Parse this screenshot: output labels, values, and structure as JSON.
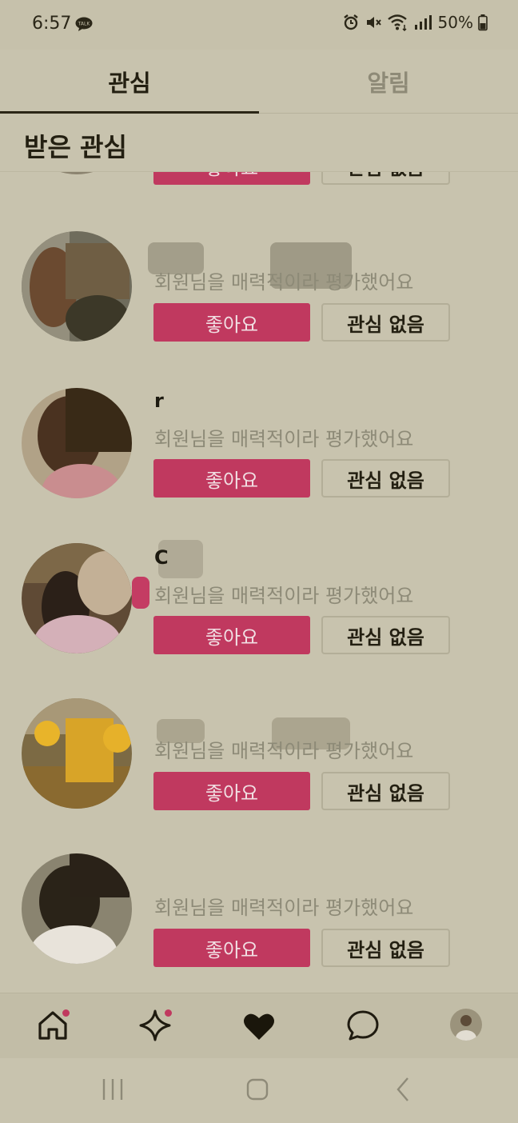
{
  "status_bar": {
    "time": "6:57",
    "talk_badge": "TALK",
    "battery": "50%"
  },
  "tabs": [
    {
      "label": "관심",
      "active": true
    },
    {
      "label": "알림",
      "active": false
    }
  ],
  "section": {
    "title": "받은 관심"
  },
  "items": [
    {
      "name": "",
      "message": "회원님을 매력적이라 평가했어요",
      "like_label": "좋아요",
      "nope_label": "관심 없음"
    },
    {
      "name": "r",
      "message": "회원님을 매력적이라 평가했어요",
      "like_label": "좋아요",
      "nope_label": "관심 없음"
    },
    {
      "name": "C",
      "message": "회원님을 매력적이라 평가했어요",
      "like_label": "좋아요",
      "nope_label": "관심 없음"
    },
    {
      "name": "",
      "message": "회원님을 매력적이라 평가했어요",
      "like_label": "좋아요",
      "nope_label": "관심 없음"
    },
    {
      "name": "",
      "message": "회원님을 매력적이라 평가했어요",
      "like_label": "좋아요",
      "nope_label": "관심 없음"
    }
  ],
  "partial_item": {
    "like_label": "좋아요",
    "nope_label": "관심 없음"
  },
  "bottom_nav": {
    "items": [
      "home-icon",
      "sparkle-icon",
      "heart-icon",
      "chat-icon",
      "profile-avatar"
    ],
    "badges": [
      "home-icon",
      "sparkle-icon"
    ]
  },
  "colors": {
    "accent": "#c0395f",
    "background": "#c8c3ae",
    "text_primary": "#231f11",
    "text_secondary": "#8d8a77"
  }
}
